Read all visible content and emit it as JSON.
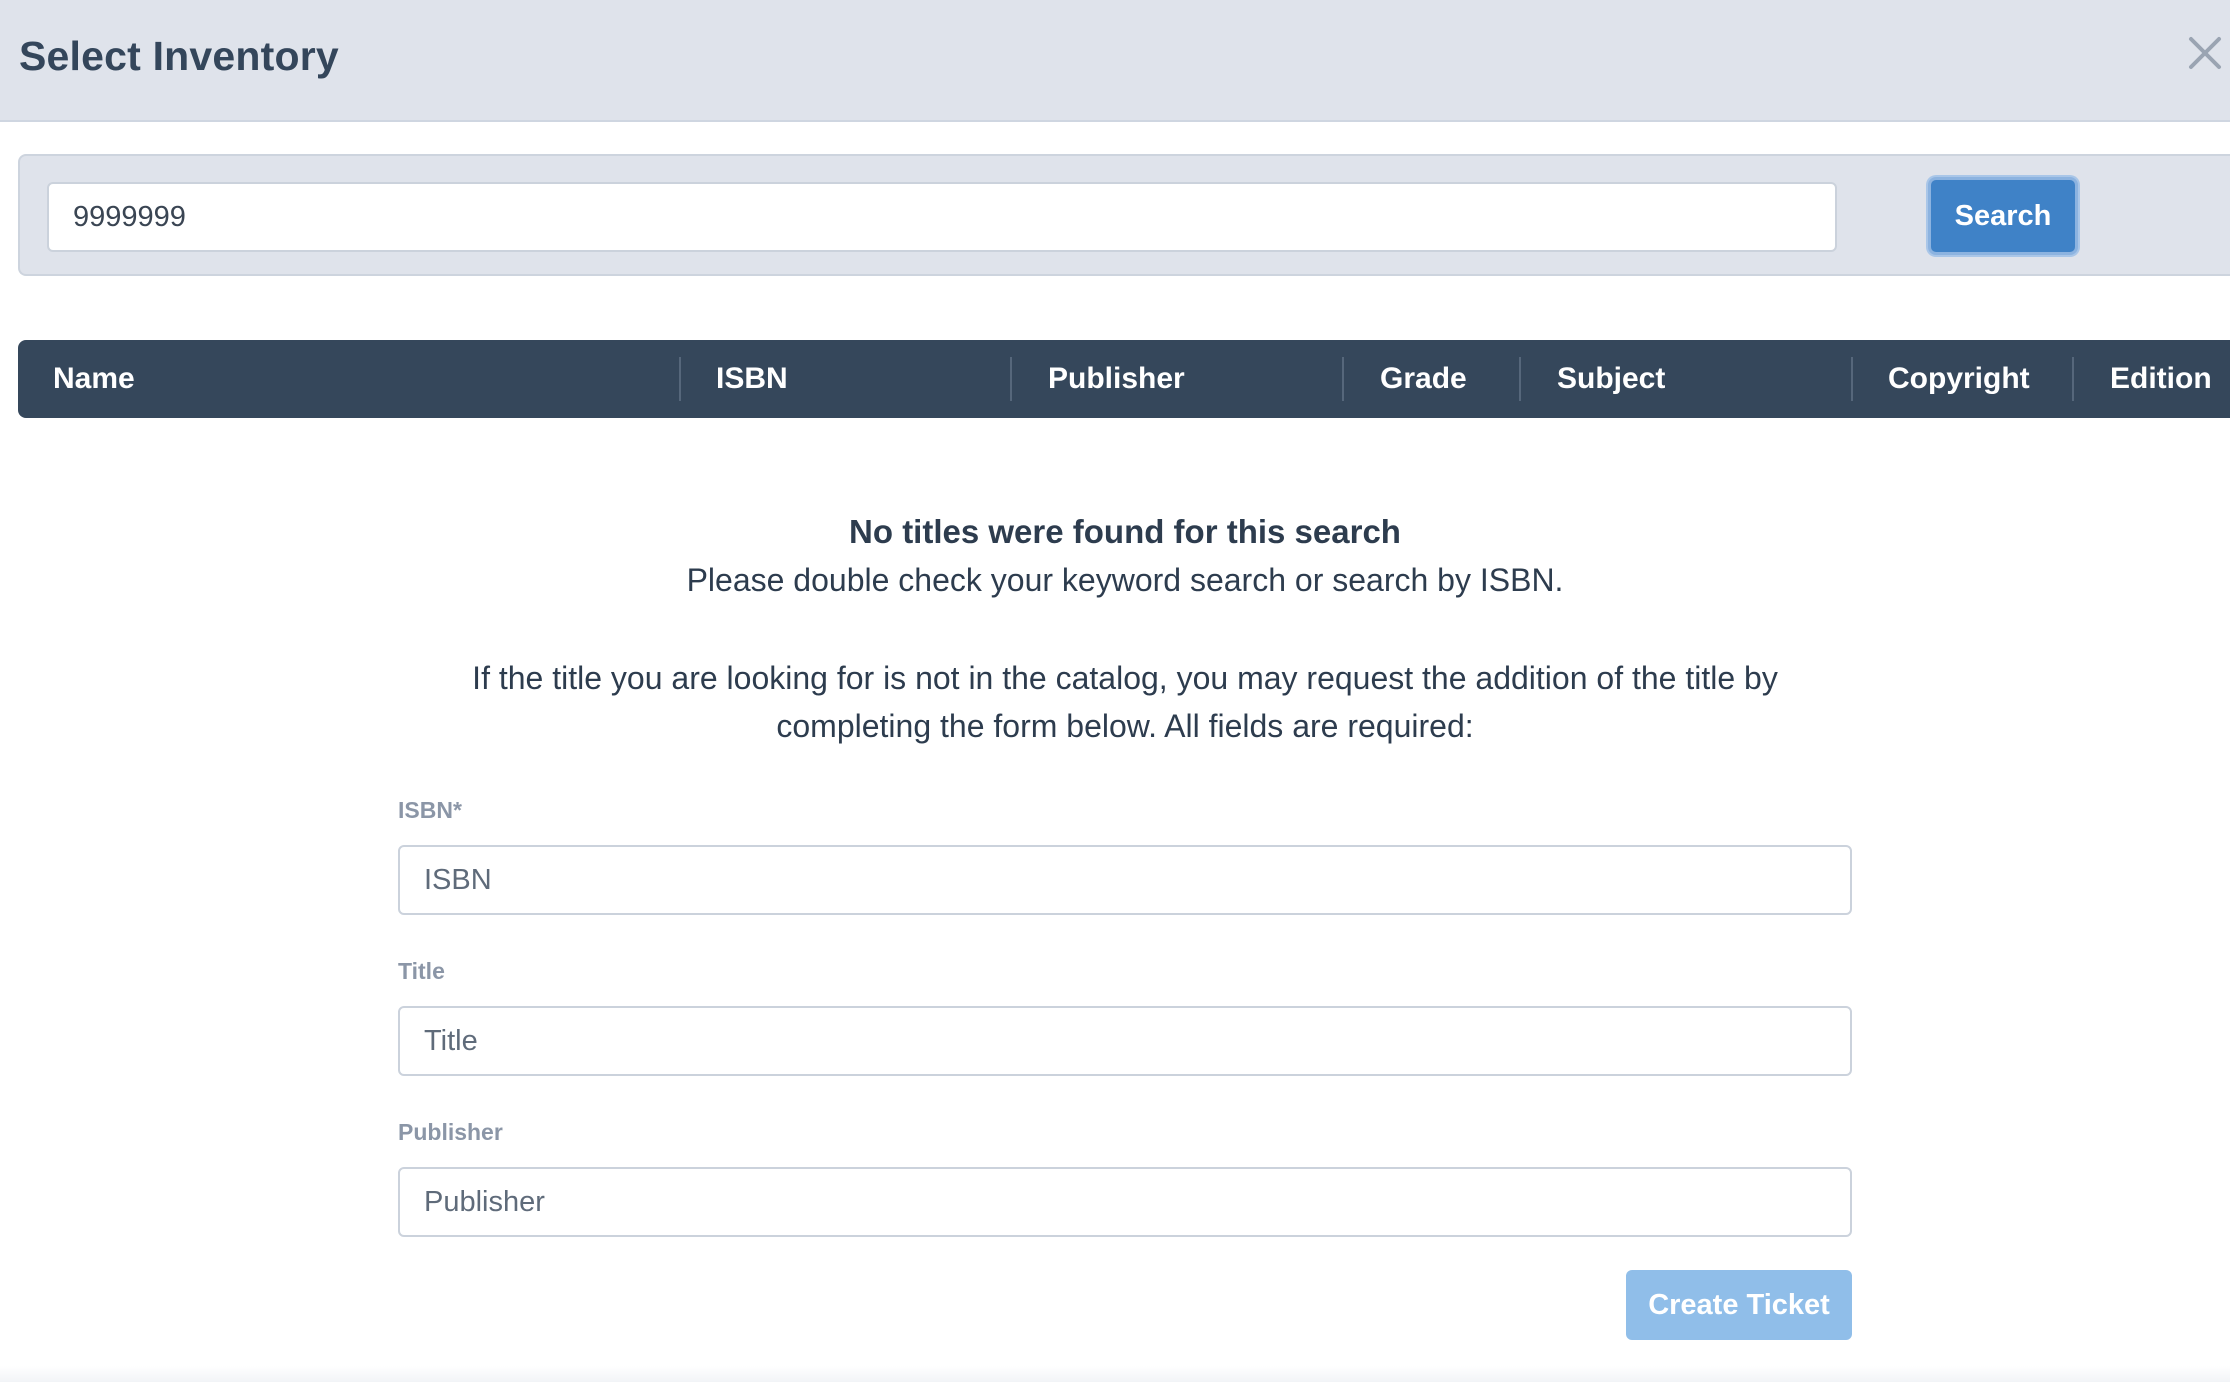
{
  "modal": {
    "title": "Select Inventory",
    "close_icon": "close-icon"
  },
  "search": {
    "value": "9999999",
    "button_label": "Search"
  },
  "table": {
    "columns": [
      "Name",
      "ISBN",
      "Publisher",
      "Grade",
      "Subject",
      "Copyright",
      "Edition"
    ]
  },
  "empty_state": {
    "title": "No titles were found for this search",
    "subtitle": "Please double check your keyword search or search by ISBN.",
    "info": "If the title you are looking for is not in the catalog, you may request the addition of the title by completing the form below. All fields are required:"
  },
  "form": {
    "isbn_label": "ISBN*",
    "isbn_placeholder": "ISBN",
    "title_label": "Title",
    "title_placeholder": "Title",
    "publisher_label": "Publisher",
    "publisher_placeholder": "Publisher",
    "submit_label": "Create Ticket"
  },
  "colors": {
    "header_bg": "#dfe3eb",
    "table_header_bg": "#35475b",
    "primary": "#3f82c7",
    "primary_disabled": "#90bee9",
    "text": "#2d3c4e"
  }
}
